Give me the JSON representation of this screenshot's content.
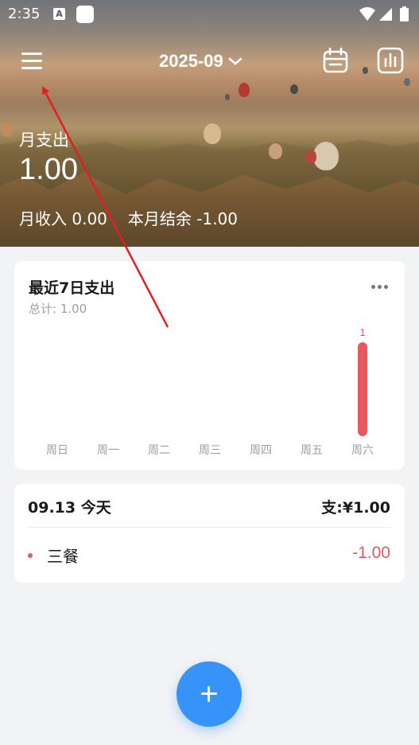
{
  "status_bar": {
    "time": "2:35",
    "notification_icons": [
      "accessibility-icon",
      "app-icon"
    ],
    "system_icons": [
      "wifi-icon",
      "signal-icon",
      "battery-icon"
    ]
  },
  "header": {
    "month": "2025-09",
    "menu_icon": "menu-icon",
    "calendar_icon": "calendar-icon",
    "stats_icon": "stats-icon",
    "month_expense_label": "月支出",
    "month_expense_value": "1.00",
    "month_income_text": "月收入 0.00",
    "month_balance_text": "本月结余 -1.00"
  },
  "weekly_card": {
    "title": "最近7日支出",
    "total_text": "总计: 1.00",
    "more_icon": "more-icon"
  },
  "chart_data": {
    "type": "bar",
    "categories": [
      "周日",
      "周一",
      "周二",
      "周三",
      "周四",
      "周五",
      "周六"
    ],
    "values": [
      0,
      0,
      0,
      0,
      0,
      0,
      1
    ],
    "data_labels": [
      "",
      "",
      "",
      "",
      "",
      "",
      "1"
    ],
    "bar_color": "#e8585f"
  },
  "day_card": {
    "date": "09.13 今天",
    "total": "支:¥1.00",
    "items": [
      {
        "name": "三餐",
        "amount": "-1.00"
      }
    ]
  },
  "fab": {
    "icon": "plus-icon"
  },
  "colors": {
    "accent": "#3793f7",
    "expense": "#e8585f",
    "annotation_arrow": "#e02020"
  }
}
